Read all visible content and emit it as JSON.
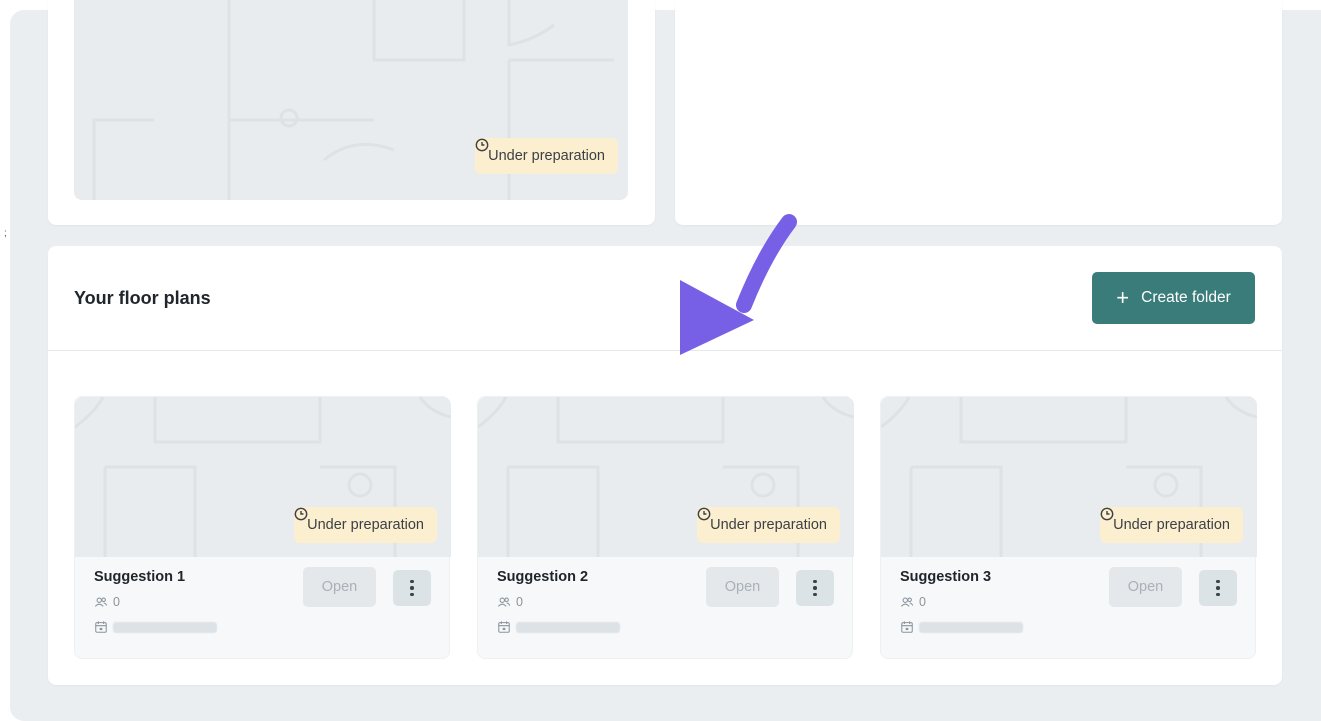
{
  "top_card": {
    "status_badge": "Under preparation"
  },
  "section": {
    "title": "Your floor plans",
    "create_button_label": "Create folder",
    "create_button_icon": "plus-icon"
  },
  "plans": [
    {
      "name": "Suggestion 1",
      "users": "0",
      "status": "Under preparation",
      "open_label": "Open"
    },
    {
      "name": "Suggestion 2",
      "users": "0",
      "status": "Under preparation",
      "open_label": "Open"
    },
    {
      "name": "Suggestion 3",
      "users": "0",
      "status": "Under preparation",
      "open_label": "Open"
    }
  ],
  "colors": {
    "accent": "#3a7c79",
    "badge_bg": "#fbefcf",
    "arrow": "#7760e6",
    "background": "#ebeef0"
  },
  "icons": {
    "status": "clock-icon",
    "users": "users-icon",
    "date": "calendar-icon",
    "more": "more-vertical-icon",
    "annotation": "curved-arrow-icon"
  }
}
